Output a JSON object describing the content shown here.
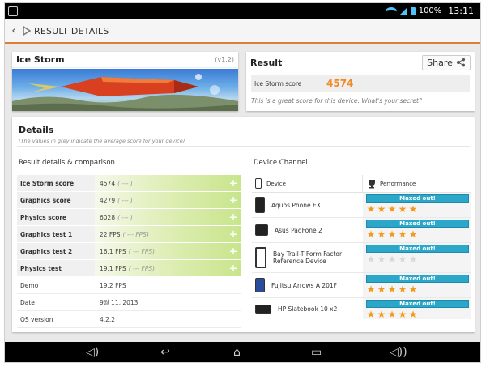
{
  "status_bar": {
    "battery": "100%",
    "time": "13:11"
  },
  "action_bar": {
    "title": "RESULT DETAILS"
  },
  "test_card": {
    "name": "Ice Storm",
    "version": "(v1.2)"
  },
  "result_card": {
    "title": "Result",
    "share_label": "Share",
    "score_label": "Ice Storm score",
    "score_value": "4574",
    "note": "This is a great score for this device. What's your secret?"
  },
  "details": {
    "title": "Details",
    "note": "(The values in grey indicate the average score for your device)",
    "comparison_title": "Result details & comparison",
    "device_channel_title": "Device Channel",
    "rows": [
      {
        "label": "Ice Storm score",
        "value": "4574",
        "avg": "( --- )"
      },
      {
        "label": "Graphics score",
        "value": "4279",
        "avg": "( --- )"
      },
      {
        "label": "Physics score",
        "value": "6028",
        "avg": "( --- )"
      },
      {
        "label": "Graphics test 1",
        "value": "22 FPS",
        "avg": "( --- FPS)"
      },
      {
        "label": "Graphics test 2",
        "value": "16.1 FPS",
        "avg": "( --- FPS)"
      },
      {
        "label": "Physics test",
        "value": "19.1 FPS",
        "avg": "( --- FPS)"
      }
    ],
    "info_rows": [
      {
        "label": "Demo",
        "value": "19.2 FPS"
      },
      {
        "label": "Date",
        "value": "9월 11, 2013"
      },
      {
        "label": "OS version",
        "value": "4.2.2"
      }
    ],
    "device_header": {
      "device": "Device",
      "performance": "Performance"
    },
    "devices": [
      {
        "name": "Aquos Phone EX",
        "status": "Maxed out!",
        "stars": 5
      },
      {
        "name": "Asus PadFone 2",
        "status": "Maxed out!",
        "stars": 5
      },
      {
        "name": "Bay Trail-T Form Factor Reference Device",
        "status": "Maxed out!",
        "stars": 0
      },
      {
        "name": "Fujitsu Arrows A 201F",
        "status": "Maxed out!",
        "stars": 5
      },
      {
        "name": "HP Slatebook 10 x2",
        "status": "Maxed out!",
        "stars": 5
      }
    ]
  },
  "colors": {
    "accent": "#e07b3c",
    "score": "#f08a24",
    "maxed_bar": "#2aa7c9",
    "star": "#f39a1e"
  }
}
